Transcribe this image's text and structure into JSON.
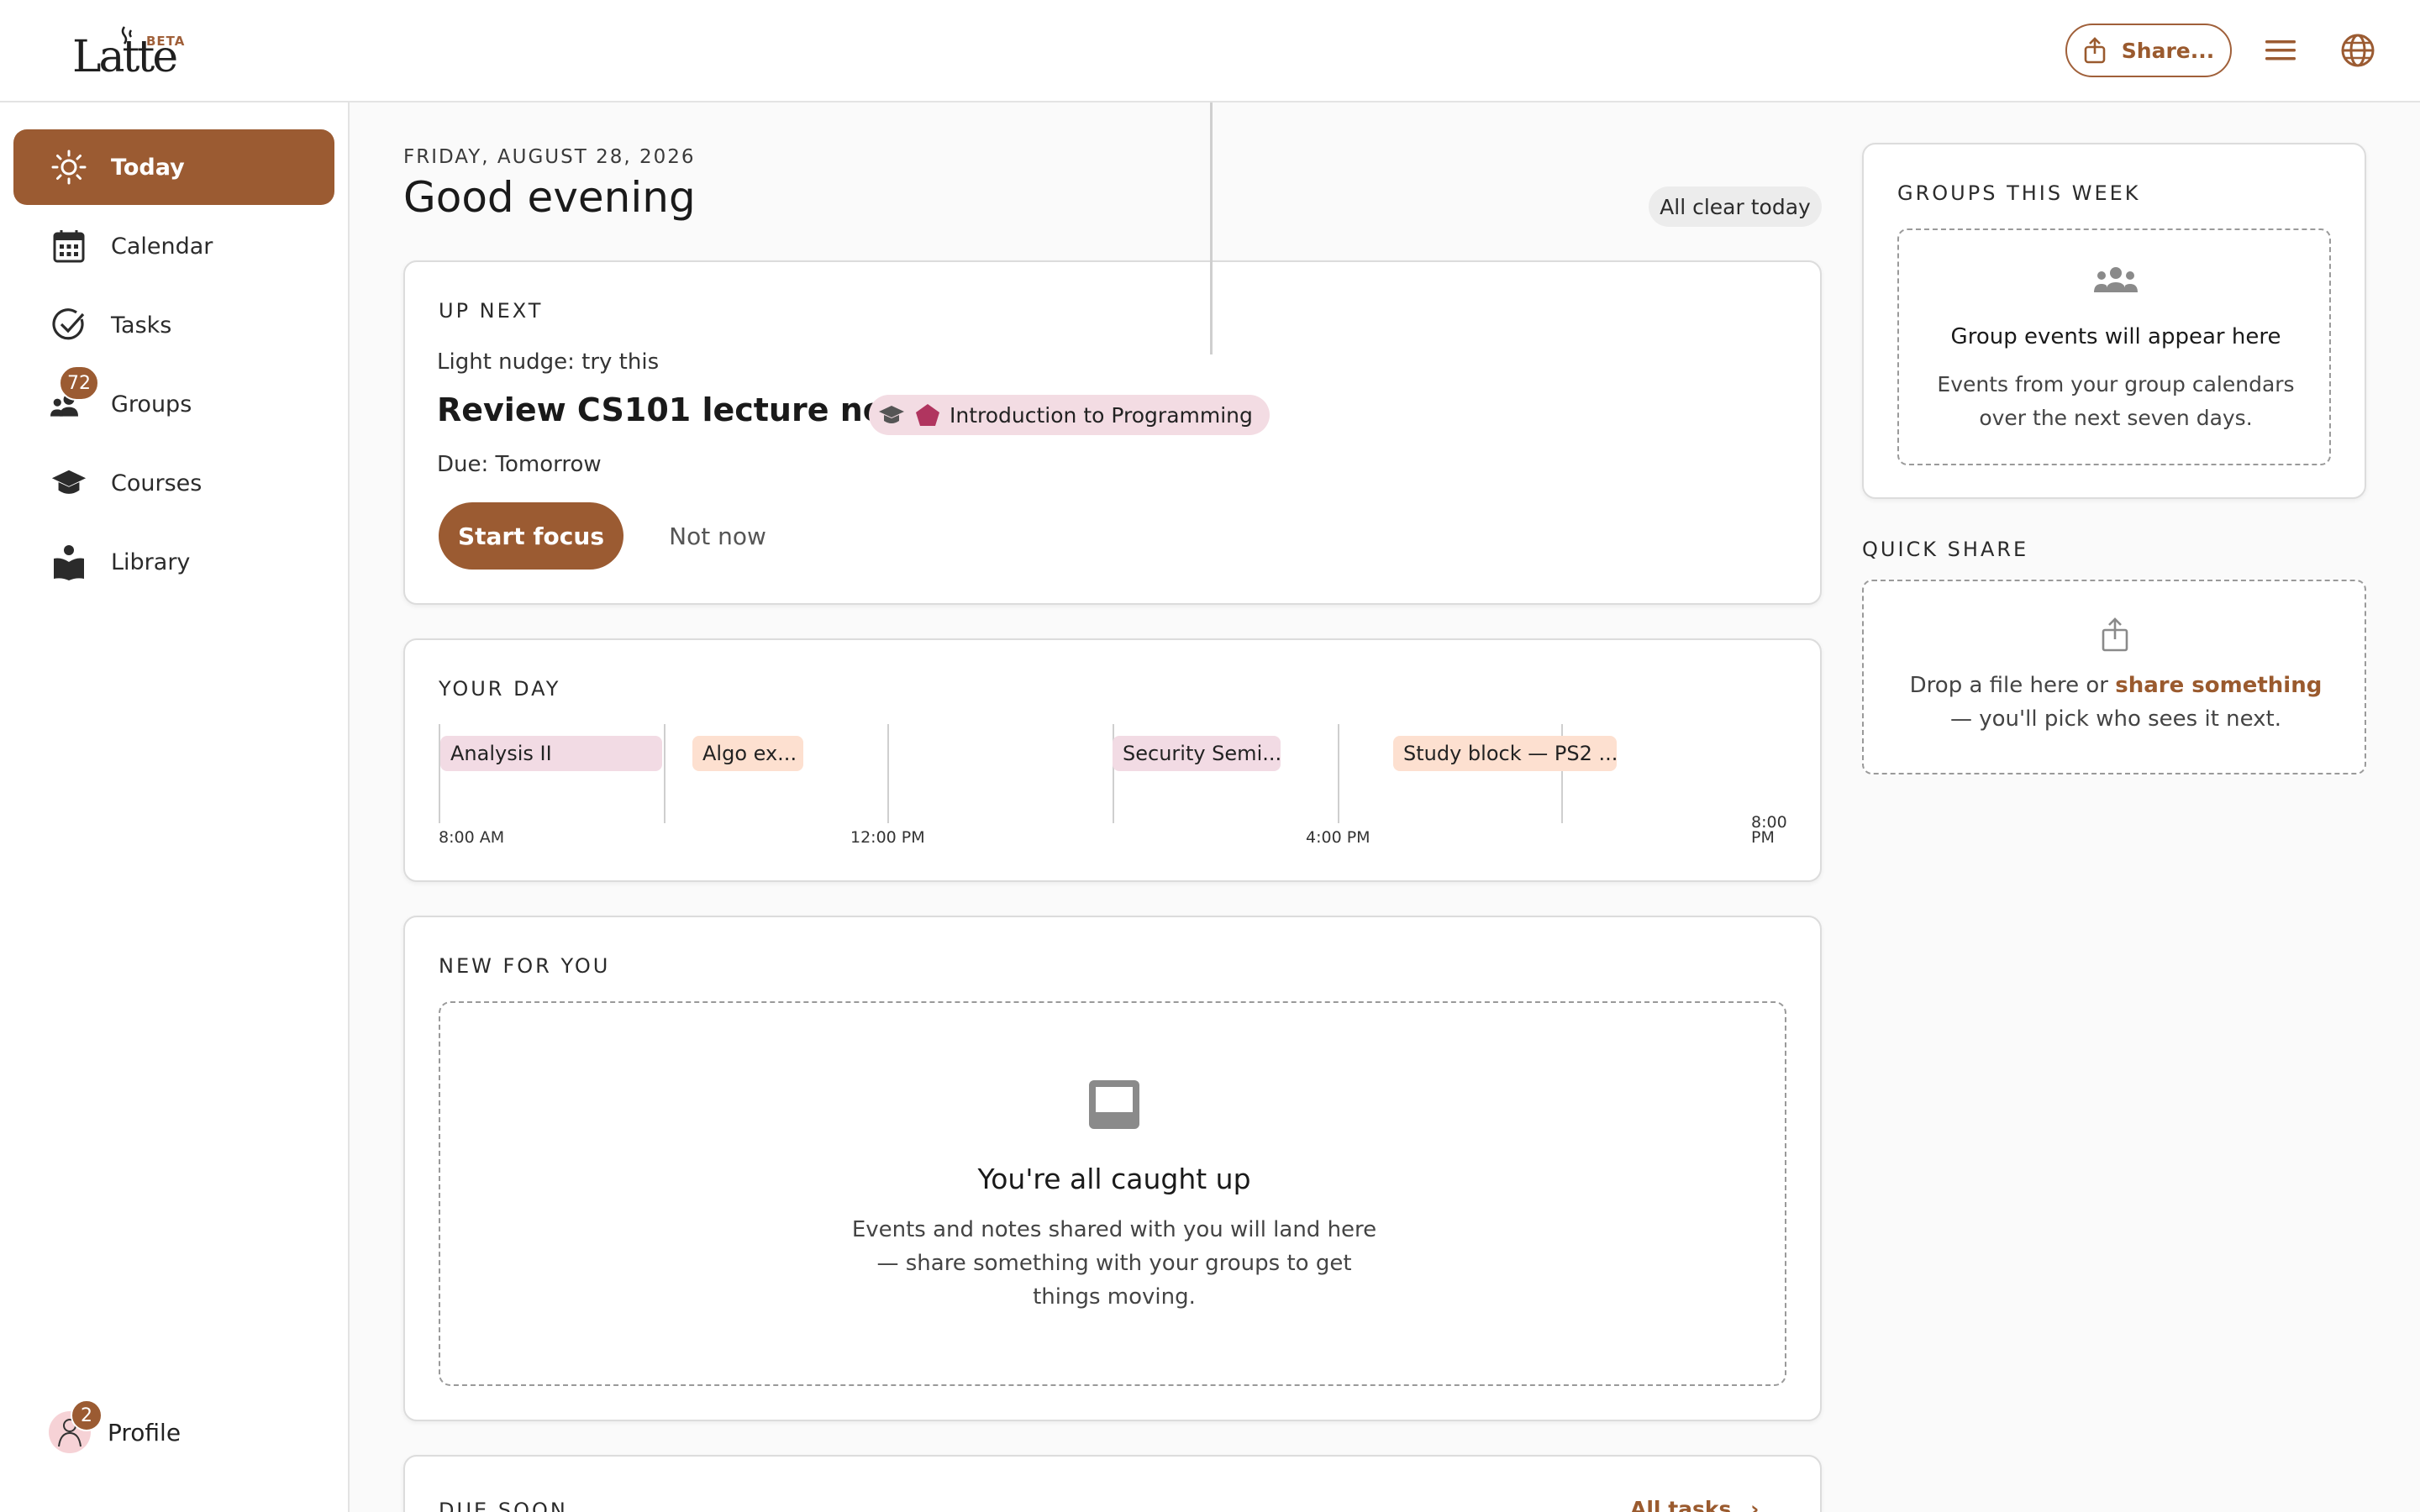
{
  "app": {
    "logo_text": "Latte",
    "beta_label": "BETA"
  },
  "header": {
    "share_label": "Share..."
  },
  "sidebar": {
    "items": [
      {
        "label": "Today",
        "icon": "sun-icon"
      },
      {
        "label": "Calendar",
        "icon": "calendar-icon"
      },
      {
        "label": "Tasks",
        "icon": "check-circle-icon"
      },
      {
        "label": "Groups",
        "icon": "groups-icon",
        "badge": "72"
      },
      {
        "label": "Courses",
        "icon": "graduation-cap-icon"
      },
      {
        "label": "Library",
        "icon": "book-icon"
      }
    ],
    "profile": {
      "label": "Profile",
      "badge": "2"
    }
  },
  "main": {
    "date": "FRIDAY, AUGUST 28, 2026",
    "greeting": "Good evening",
    "status_pill": "All clear today",
    "up_next": {
      "title": "UP NEXT",
      "nudge": "Light nudge: try this",
      "task": "Review CS101 lecture notes",
      "course": "Introduction to Programming",
      "due": "Due: Tomorrow",
      "start_label": "Start focus",
      "dismiss_label": "Not now"
    },
    "your_day": {
      "title": "YOUR DAY",
      "events": [
        {
          "label": "Analysis II",
          "color": "#f2dbe4"
        },
        {
          "label": "Algo ex...",
          "color": "#fde0d0"
        },
        {
          "label": "Security Semi...",
          "color": "#f2dbe4"
        },
        {
          "label": "Study block — PS2 ...",
          "color": "#fde0d0"
        }
      ],
      "time_labels": [
        "8:00 AM",
        "12:00 PM",
        "4:00 PM",
        "8:00",
        "PM"
      ]
    },
    "new_for_you": {
      "title": "NEW FOR YOU",
      "empty_title": "You're all caught up",
      "empty_body": "Events and notes shared with you will land here — share something with your groups to get things moving."
    },
    "due_soon": {
      "title": "DUE SOON",
      "link": "All tasks"
    }
  },
  "right": {
    "groups_week": {
      "title": "GROUPS THIS WEEK",
      "empty_title": "Group events will appear here",
      "empty_body": "Events from your group calendars over the next seven days."
    },
    "quick_share": {
      "title": "QUICK SHARE",
      "text_before": "Drop a file here or ",
      "link": "share something",
      "text_after": " — you'll pick who sees it next."
    }
  },
  "colors": {
    "accent": "#9b5b32",
    "pink_chip": "#f3dce3",
    "peach_chip": "#fde0d0"
  }
}
